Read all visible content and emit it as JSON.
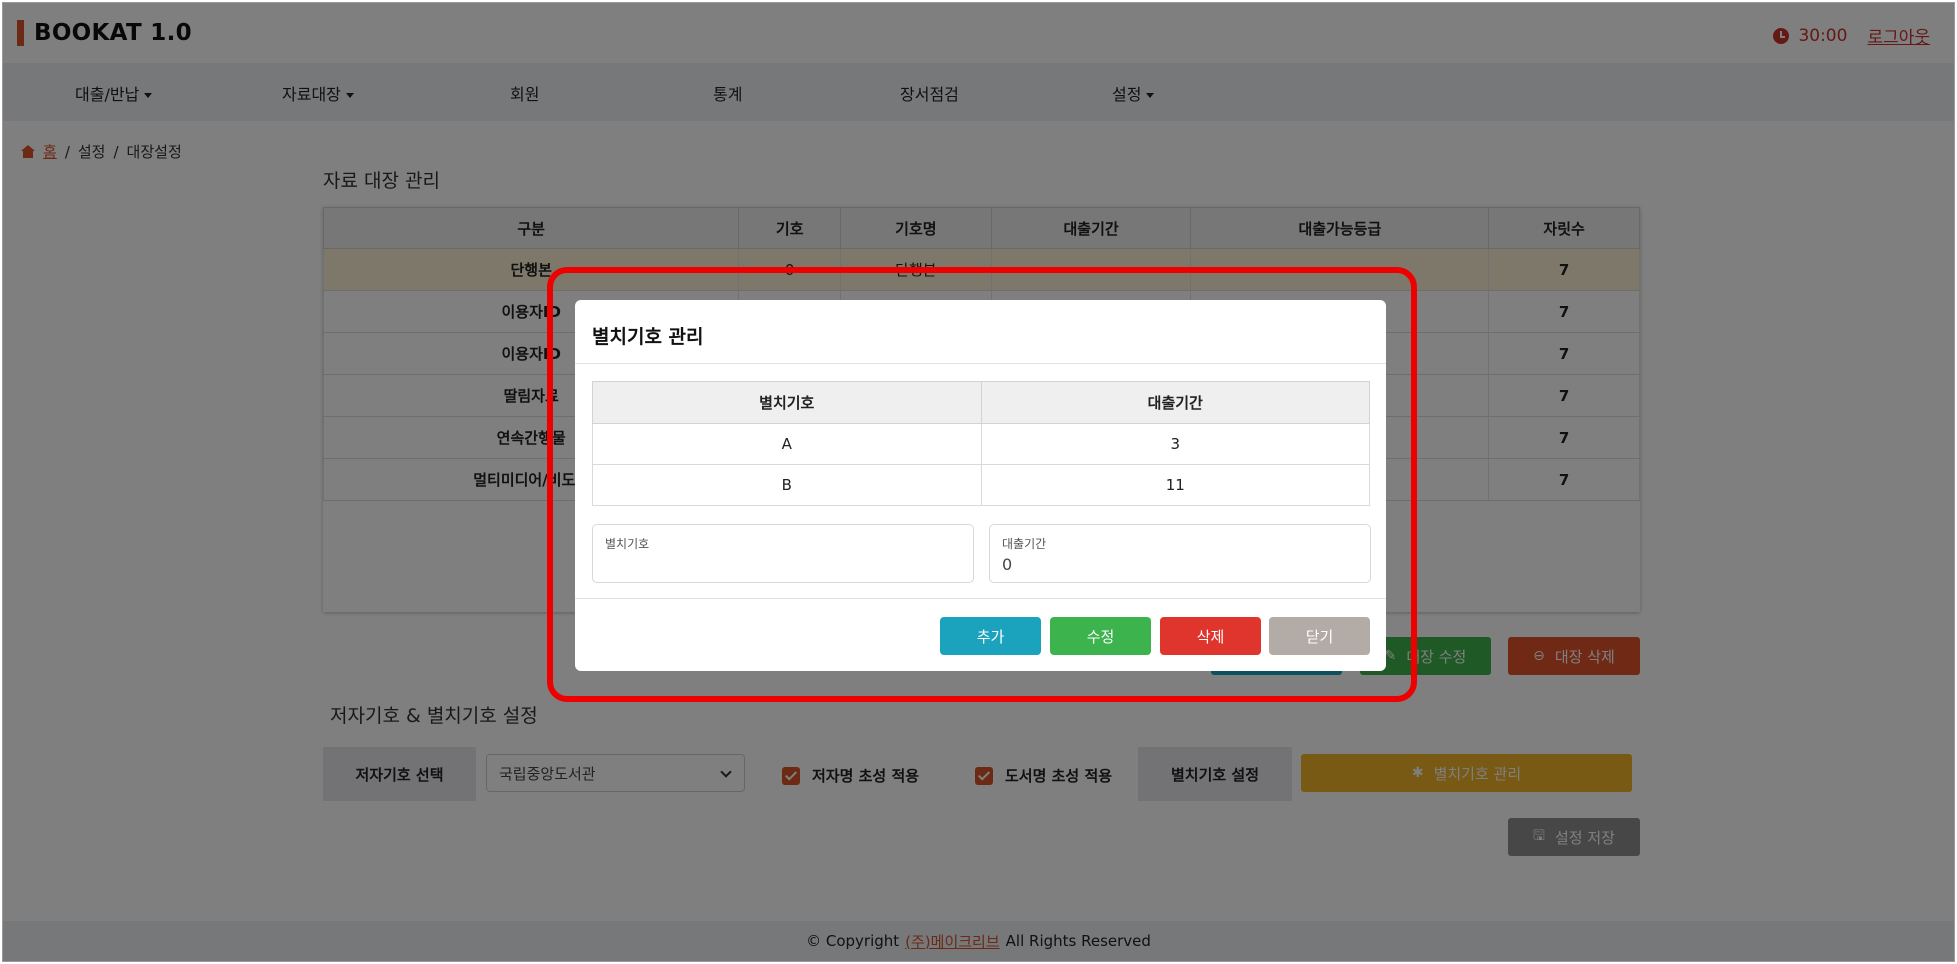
{
  "header": {
    "app_title": "BOOKAT 1.0",
    "timer": "30:00",
    "logout": "로그아웃"
  },
  "nav": {
    "items": [
      {
        "label": "대출/반납",
        "dropdown": true
      },
      {
        "label": "자료대장",
        "dropdown": true
      },
      {
        "label": "회원",
        "dropdown": false
      },
      {
        "label": "통계",
        "dropdown": false
      },
      {
        "label": "장서점검",
        "dropdown": false
      },
      {
        "label": "설정",
        "dropdown": true
      }
    ]
  },
  "breadcrumb": {
    "home": "홈",
    "sep": "/",
    "level1": "설정",
    "level2": "대장설정"
  },
  "ledger": {
    "title": "자료 대장 관리",
    "columns": [
      "구분",
      "기호",
      "기호명",
      "대출기간",
      "대출가능등급",
      "자릿수"
    ],
    "rows": [
      [
        "단행본",
        "0",
        "단행본",
        "",
        "",
        "7"
      ],
      [
        "이용자ID",
        "",
        "",
        "",
        "",
        "7"
      ],
      [
        "이용자ID",
        "",
        "",
        "",
        "",
        "7"
      ],
      [
        "딸림자료",
        "",
        "",
        "",
        "",
        "7"
      ],
      [
        "연속간행물",
        "",
        "",
        "",
        "",
        "7"
      ],
      [
        "멀티미디어/비도서",
        "",
        "",
        "",
        "",
        "7"
      ]
    ],
    "edit_button": "대장 수정",
    "delete_button": "대장 삭제"
  },
  "author_section": {
    "title": "저자기호 & 별치기호 설정",
    "select_label": "저자기호 선택",
    "select_value": "국립중앙도서관",
    "check_author": "저자명 초성 적용",
    "check_book": "도서명 초성 적용",
    "special_label": "별치기호 설정",
    "special_button": "별치기호 관리",
    "save_button": "설정 저장"
  },
  "footer": {
    "copyright": "© Copyright",
    "company": "(주)메이크리브",
    "rights": "All Rights Reserved"
  },
  "modal": {
    "title": "별치기호 관리",
    "columns": [
      "별치기호",
      "대출기간"
    ],
    "rows": [
      [
        "A",
        "3"
      ],
      [
        "B",
        "11"
      ]
    ],
    "field_code_label": "별치기호",
    "field_code_value": "",
    "field_period_label": "대출기간",
    "field_period_value": "0",
    "buttons": {
      "add": "추가",
      "edit": "수정",
      "delete": "삭제",
      "close": "닫기"
    }
  },
  "colors": {
    "brand": "#d9542a",
    "teal": "#1ba2bd",
    "green": "#3cb34d",
    "red": "#e0352c",
    "gray": "#b3aca6",
    "gold": "#f0b429",
    "annotation": "#ee0000"
  }
}
